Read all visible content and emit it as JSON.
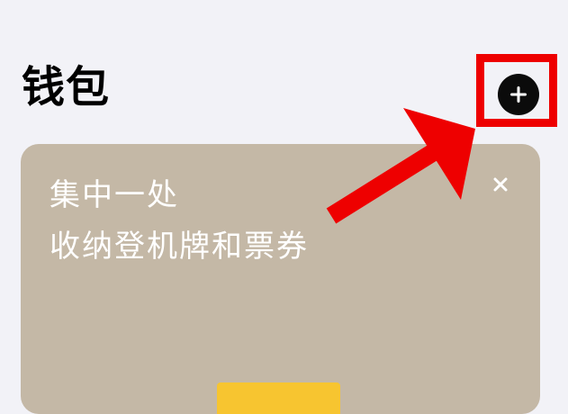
{
  "header": {
    "title": "钱包",
    "add_icon": "plus-icon"
  },
  "promo_card": {
    "line1": "集中一处",
    "line2": "收纳登机牌和票券",
    "close_icon": "close-icon",
    "background_color": "#c4b8a6",
    "cta_color": "#f7c530"
  },
  "annotation": {
    "highlight_color": "#ee0000",
    "arrow_color": "#ee0000"
  },
  "colors": {
    "background": "#f2f2f7",
    "add_button": "#0b0b0b"
  }
}
